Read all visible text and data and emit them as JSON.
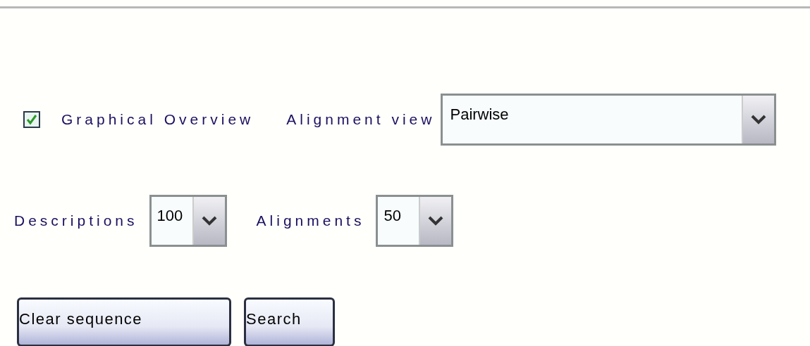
{
  "options": [
    {
      "kind": "checkbox",
      "label": "Graphical Overview",
      "checked": true
    },
    {
      "kind": "select",
      "label": "Alignment view",
      "value": "Pairwise"
    }
  ],
  "limits": [
    {
      "kind": "select",
      "label": "Descriptions",
      "value": "100"
    },
    {
      "kind": "select",
      "label": "Alignments",
      "value": "50"
    }
  ],
  "buttons": [
    {
      "label": "Clear sequence"
    },
    {
      "label": "Search"
    }
  ]
}
